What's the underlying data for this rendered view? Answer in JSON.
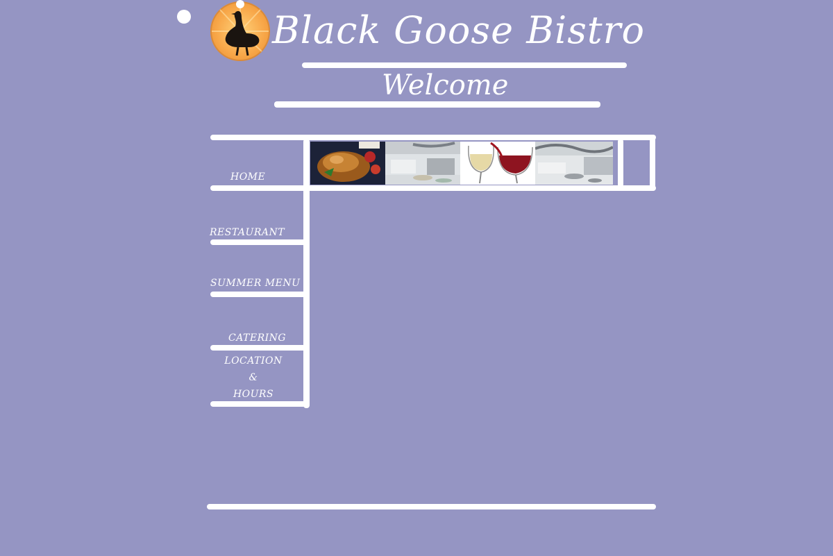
{
  "site": {
    "title": "Black Goose Bistro",
    "page_heading": "Welcome"
  },
  "nav": {
    "items": [
      {
        "label": "HOME"
      },
      {
        "label": "RESTAURANT"
      },
      {
        "label": "SUMMER MENU"
      },
      {
        "label": "CATERING"
      },
      {
        "label_lines": [
          "LOCATION",
          "&",
          "HOURS"
        ]
      }
    ]
  },
  "banner": {
    "photos": [
      {
        "name": "roast-chicken-photo"
      },
      {
        "name": "dining-room-photo"
      },
      {
        "name": "wine-glasses-photo"
      },
      {
        "name": "restaurant-interior-photo"
      }
    ]
  },
  "colors": {
    "background": "#9595c3",
    "lines": "#ffffff",
    "logo_orange": "#f8a84a"
  }
}
